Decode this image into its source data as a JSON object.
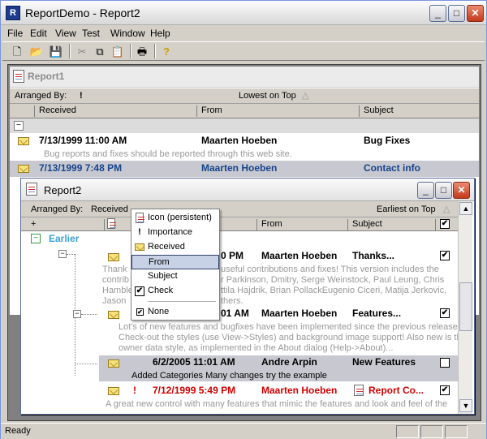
{
  "window": {
    "title": "ReportDemo - Report2",
    "app_icon_glyph": "R",
    "controls": [
      "_",
      "□",
      "✕"
    ]
  },
  "menu": [
    "File",
    "Edit",
    "View",
    "Test",
    "Window",
    "Help"
  ],
  "toolbar_icons": [
    "new-icon",
    "open-icon",
    "save-icon",
    "cut-icon",
    "copy-icon",
    "paste-icon",
    "print-icon",
    "help-icon"
  ],
  "toolbar_glyphs": [
    "🗋",
    "📂",
    "💾",
    "✂",
    "⧉",
    "📋",
    "🖶",
    "?"
  ],
  "status": {
    "text": "Ready"
  },
  "report1": {
    "title": "Report1",
    "arranged_label": "Arranged By:",
    "arranged_icon": "!",
    "sort_label": "Lowest on Top",
    "sort_arrow": "△",
    "columns": [
      "Received",
      "From",
      "Subject"
    ],
    "group_toggle": "−",
    "rows": [
      {
        "received": "7/13/1999 11:00 AM",
        "from": "Maarten Hoeben",
        "subject": "Bug Fixes",
        "preview": "Bug reports and fixes should be reported through this web site."
      },
      {
        "received": "7/13/1999 7:48 PM",
        "from": "Maarten Hoeben",
        "subject": "Contact info"
      }
    ]
  },
  "report2": {
    "title": "Report2",
    "arranged_label": "Arranged By:",
    "arranged_value": "Received",
    "sort_label": "Earliest on Top",
    "sort_arrow": "△",
    "columns": {
      "plus": "+",
      "from": "From",
      "subject": "Subject",
      "check": "✔"
    },
    "group_toggle": "−",
    "group": "Earlier",
    "rows": [
      {
        "received": "0 PM",
        "from": "Maarten Hoeben",
        "subject": "Thanks...",
        "checked": "✔",
        "preview_lines": [
          "Thank",
          "useful contributions and fixes! This version includes the",
          "contrib",
          "r Parkinson, Dmitry, Serge Weinstock, Paul Leung, Chris",
          "Hamble",
          "ttila Hajdrik, Brian PollackEugenio Ciceri, Matija Jerkovic,",
          "Jason",
          "thers."
        ]
      },
      {
        "received": "01 AM",
        "from": "Maarten Hoeben",
        "subject": "Features...",
        "checked": "✔",
        "preview_lines": [
          "Lot's of new features and bugfixes have been implemented since the previous release.",
          "Check-out the styles (use View->Styles) and background image support! Also new is the",
          "owner data style, as implemented in the About dialog (Help->About)..."
        ]
      },
      {
        "received": "6/2/2005 11:01 AM",
        "from": "Andre Arpin",
        "subject": "New Features",
        "checked": "",
        "preview": "Added Categories Many changes try the example"
      },
      {
        "importance": "!",
        "received": "7/12/1999 5:49 PM",
        "from": "Maarten Hoeben",
        "subject": "Report Co...",
        "checked": "✔",
        "preview": "A great new control with many features that mimic the features and look and feel of the"
      }
    ]
  },
  "popup": {
    "items": [
      {
        "label": "Icon (persistent)",
        "icon": "doc-icon"
      },
      {
        "label": "Importance",
        "icon": "exclamation-icon",
        "glyph": "!"
      },
      {
        "label": "Received",
        "icon": "envelope-icon"
      },
      {
        "label": "From",
        "icon": "none"
      },
      {
        "label": "Subject",
        "icon": "none"
      },
      {
        "label": "Check",
        "icon": "checkbox-icon",
        "glyph": "✔"
      },
      {
        "label": "None",
        "icon": "checkbox-icon",
        "glyph": "✔"
      }
    ]
  }
}
